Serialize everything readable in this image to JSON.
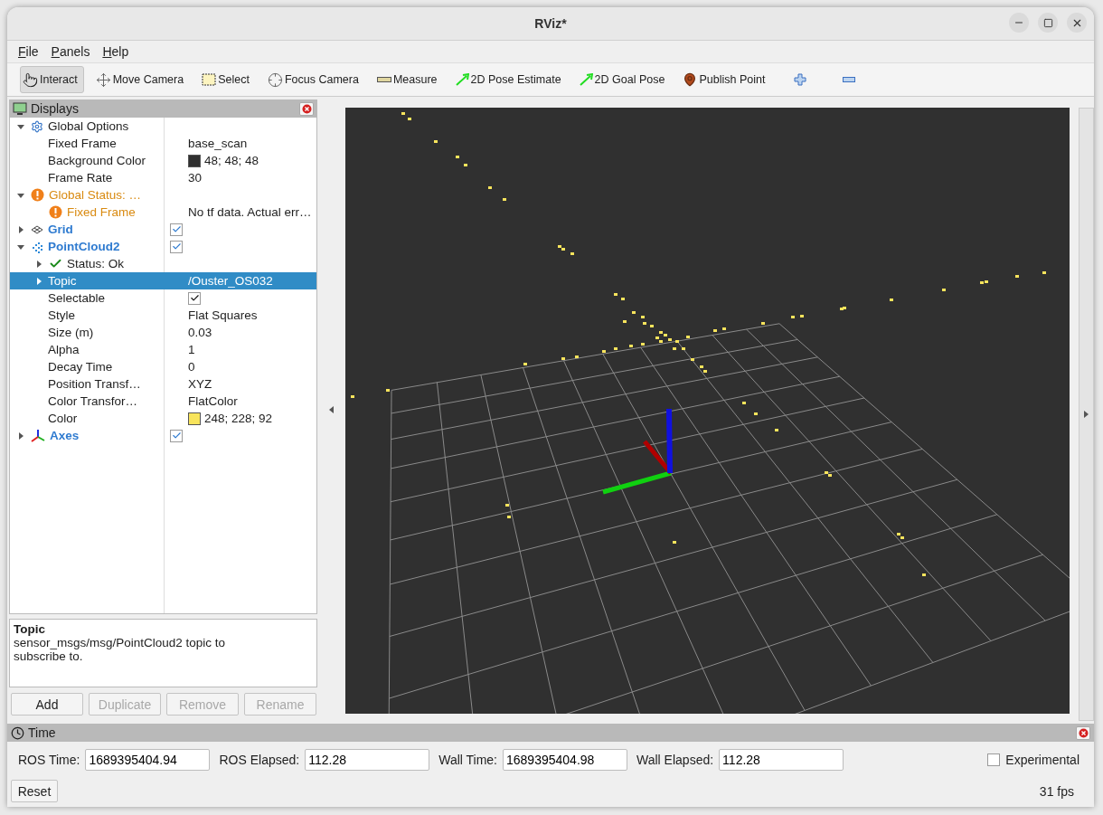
{
  "window": {
    "title": "RViz*"
  },
  "menu": [
    "File",
    "Panels",
    "Help"
  ],
  "toolbar": {
    "tools": [
      {
        "kind": "interact",
        "label": "Interact",
        "selected": true
      },
      {
        "kind": "move",
        "label": "Move Camera",
        "selected": false
      },
      {
        "kind": "select",
        "label": "Select",
        "selected": false
      },
      {
        "kind": "focus",
        "label": "Focus Camera",
        "selected": false
      },
      {
        "kind": "measure",
        "label": "Measure",
        "selected": false
      },
      {
        "kind": "pose",
        "label": "2D Pose Estimate",
        "selected": false
      },
      {
        "kind": "pose",
        "label": "2D Goal Pose",
        "selected": false
      },
      {
        "kind": "point",
        "label": "Publish Point",
        "selected": false
      },
      {
        "kind": "add",
        "selected": false
      },
      {
        "kind": "remove",
        "selected": false
      }
    ]
  },
  "displays": {
    "title": "Displays",
    "rows": [
      {
        "kind": "options",
        "label": "Global Options",
        "expanded": true,
        "selected": false,
        "children": [
          {
            "kind": "property",
            "label": "Fixed Frame",
            "value": "base_scan",
            "selected": false
          },
          {
            "kind": "property",
            "label": "Background Color",
            "value": "48; 48; 48",
            "color": "#303030",
            "selected": false
          },
          {
            "kind": "property",
            "label": "Frame Rate",
            "value": "30",
            "selected": false
          }
        ]
      },
      {
        "kind": "warning",
        "label": "Global Status: …",
        "expanded": true,
        "selected": false,
        "children": [
          {
            "kind": "warning",
            "label": "Fixed Frame",
            "value": "No tf data.  Actual err…",
            "selected": false
          }
        ]
      },
      {
        "kind": "grid",
        "label": "Grid",
        "expanded": false,
        "checked": true,
        "selected": false
      },
      {
        "kind": "cloud",
        "label": "PointCloud2",
        "expanded": true,
        "checked": true,
        "selected": false,
        "children": [
          {
            "kind": "ok",
            "label": "Status: Ok",
            "expanded": false,
            "selected": false
          },
          {
            "kind": "property",
            "label": "Topic",
            "value": "/Ouster_OS032",
            "expanded": false,
            "selected": true
          },
          {
            "kind": "property",
            "label": "Selectable",
            "checked": true,
            "selected": false
          },
          {
            "kind": "property",
            "label": "Style",
            "value": "Flat Squares",
            "selected": false
          },
          {
            "kind": "property",
            "label": "Size (m)",
            "value": "0.03",
            "selected": false
          },
          {
            "kind": "property",
            "label": "Alpha",
            "value": "1",
            "selected": false
          },
          {
            "kind": "property",
            "label": "Decay Time",
            "value": "0",
            "selected": false
          },
          {
            "kind": "property",
            "label": "Position Transf…",
            "value": "XYZ",
            "selected": false
          },
          {
            "kind": "property",
            "label": "Color Transfor…",
            "value": "FlatColor",
            "selected": false
          },
          {
            "kind": "property",
            "label": "Color",
            "value": "248; 228; 92",
            "color": "#f8e45c",
            "selected": false
          }
        ]
      },
      {
        "kind": "axes",
        "label": "Axes",
        "expanded": false,
        "checked": true,
        "selected": false
      }
    ],
    "description": {
      "title": "Topic",
      "text": "sensor_msgs/msg/PointCloud2 topic to subscribe to."
    },
    "buttons": [
      {
        "label": "Add",
        "disabled": false
      },
      {
        "label": "Duplicate",
        "disabled": true
      },
      {
        "label": "Remove",
        "disabled": true
      },
      {
        "label": "Rename",
        "disabled": true
      }
    ]
  },
  "time": {
    "title": "Time",
    "fields": [
      {
        "label": "ROS Time:",
        "value": "1689395404.94"
      },
      {
        "label": "ROS Elapsed:",
        "value": "112.28"
      },
      {
        "label": "Wall Time:",
        "value": "1689395404.98"
      },
      {
        "label": "Wall Elapsed:",
        "value": "112.28"
      }
    ],
    "experimental": {
      "label": "Experimental",
      "checked": false
    },
    "reset": "Reset",
    "fps": "31 fps"
  }
}
